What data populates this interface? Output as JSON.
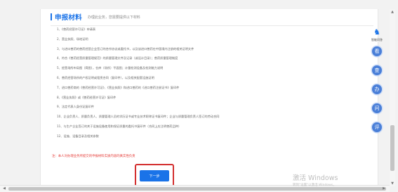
{
  "header": {
    "title": "申报材料",
    "subtitle": "办理此业务，您需要提供以下材料"
  },
  "materials": [
    "1、《兽药经营许可证》申请表",
    "2、营业执照、场地证明",
    "3、与进口兽药的兽药经营企业签订的合作协议或委托书，以及该进口兽药在中国境内注册的相关证明文件",
    "4、符合《兽药经营质量管理规范》的质量管理文件及记录（或设计目录）；兽药质量管理制度",
    "5、经营场所布局图（简图），仓库（场所）平面图；计量检测设备及检测能力说明",
    "6、兽药经营场所的产权证明或租赁合同（复印件），以及相关配套设施证明",
    "7、进口兽药商的《兽药经营许可证》、《营业执照》和进口兽药的《进口兽药注册证书》复印件",
    "8、《营业执照》或《兽药经营许可证》复印件",
    "9、法定代表人身份证复印件",
    "10、企业负责人、质量负责人、质量管理人员的学历证书或专业技术职称证书复印件；企业与质量管理负责人签订的劳动合同",
    "11、与生产企业签订的关于设施设备使用和保证质量的委托书复印件（合同上应注明兽药品种）",
    "12、设施、设备目录及相关参数"
  ],
  "warning": "注：本人对办理业务所提交的申报材料实质内容的真实性负责",
  "next_button": "下一步",
  "sidebar": {
    "top_label": "智能问答",
    "circles": [
      "看",
      "查",
      "办",
      "问",
      "评"
    ]
  },
  "watermark": {
    "line1": "激活 Windows",
    "line2": "转到\"设置\"以激活 Windows。"
  },
  "colors": {
    "accent": "#1a73e8",
    "warning": "#e53935",
    "highlight_border": "#d32f2f"
  }
}
